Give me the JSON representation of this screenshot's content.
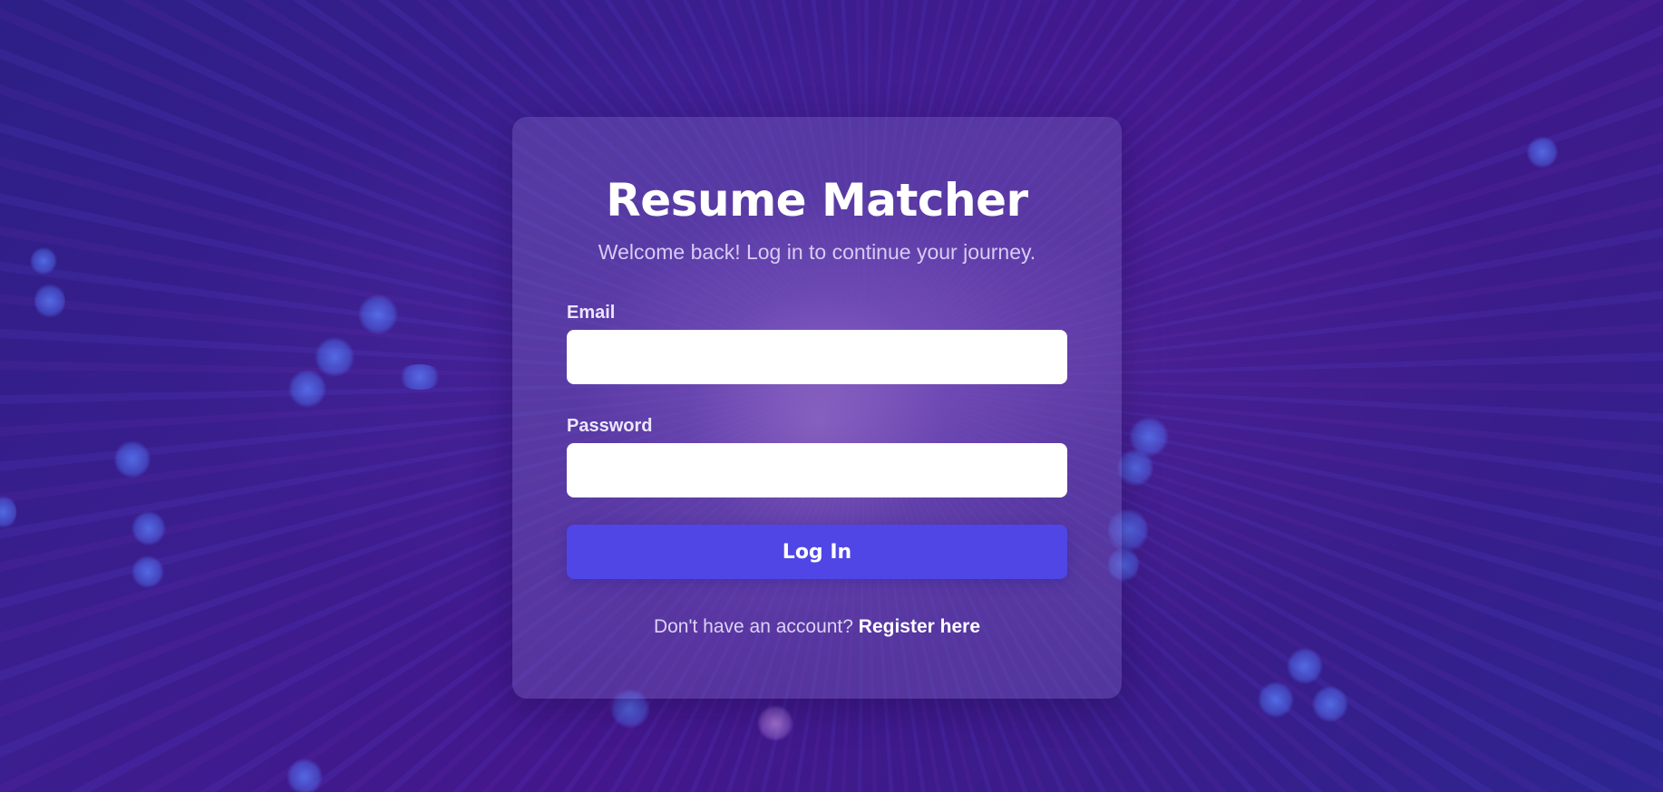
{
  "app": {
    "title": "Resume Matcher",
    "subtitle": "Welcome back! Log in to continue your journey."
  },
  "form": {
    "email_label": "Email",
    "email_value": "",
    "password_label": "Password",
    "password_value": "",
    "submit_label": "Log In"
  },
  "footer": {
    "prompt": "Don't have an account?",
    "register_link": "Register here"
  },
  "colors": {
    "accent": "#4f46e5",
    "background_dark": "#2c1f86",
    "background_purple": "#43178c"
  }
}
